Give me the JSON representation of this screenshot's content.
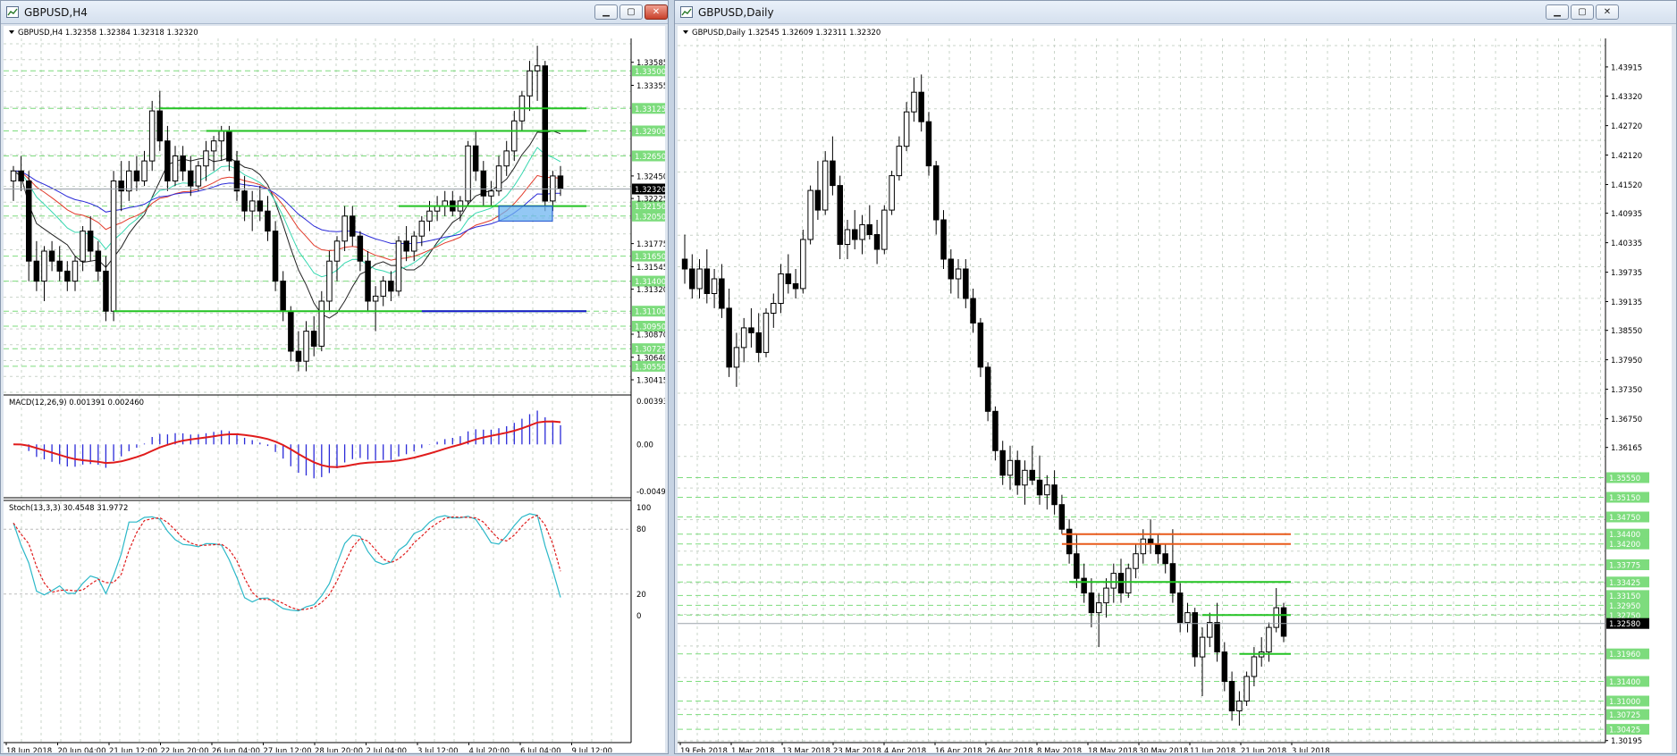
{
  "windows": [
    {
      "title": "GBPUSD,H4",
      "header": "GBPUSD,H4  1.32358 1.32384 1.32318 1.32320",
      "price_range": [
        1.3029,
        1.3377
      ],
      "price_ticks": [
        "1.33585",
        "1.33355",
        "1.32450",
        "1.32225",
        "1.31775",
        "1.31545",
        "1.31320",
        "1.30870",
        "1.30640",
        "1.30415"
      ],
      "current_price": "1.32320",
      "levels": [
        {
          "label": "1.33500",
          "price": 1.335
        },
        {
          "label": "1.33125",
          "price": 1.33125
        },
        {
          "label": "1.32900",
          "price": 1.329
        },
        {
          "label": "1.32650",
          "price": 1.3265
        },
        {
          "label": "1.32150",
          "price": 1.3215
        },
        {
          "label": "1.32050",
          "price": 1.3205
        },
        {
          "label": "1.31650",
          "price": 1.3165
        },
        {
          "label": "1.31400",
          "price": 1.314
        },
        {
          "label": "1.31100",
          "price": 1.311
        },
        {
          "label": "1.30950",
          "price": 1.3095
        },
        {
          "label": "1.30725",
          "price": 1.30725
        },
        {
          "label": "1.30550",
          "price": 1.3055
        }
      ],
      "date_labels": [
        "18 Jun 2018",
        "20 Jun 04:00",
        "21 Jun 12:00",
        "22 Jun 20:00",
        "26 Jun 04:00",
        "27 Jun 12:00",
        "28 Jun 20:00",
        "2 Jul 04:00",
        "3 Jul 12:00",
        "4 Jul 20:00",
        "6 Jul 04:00",
        "9 Jul 12:00"
      ],
      "macd": {
        "header": "MACD(12,26,9) 0.001391 0.002460",
        "ticks": [
          "0.003935",
          "0.00",
          "-0.00494"
        ]
      },
      "stoch": {
        "header": "Stoch(13,3,3) 30.4548 31.9772",
        "ticks": [
          "100",
          "80",
          "20",
          "0"
        ]
      }
    },
    {
      "title": "GBPUSD,Daily",
      "header": "GBPUSD,Daily  1.32545 1.32609 1.32311 1.32320",
      "price_range": [
        1.3019,
        1.4435
      ],
      "price_ticks": [
        "1.43915",
        "1.43320",
        "1.42720",
        "1.42120",
        "1.41520",
        "1.40935",
        "1.40335",
        "1.39735",
        "1.39135",
        "1.38550",
        "1.37950",
        "1.37350",
        "1.36750",
        "1.36165",
        "1.30195"
      ],
      "current_price": "1.32580",
      "levels": [
        {
          "label": "1.35550",
          "price": 1.3555
        },
        {
          "label": "1.35150",
          "price": 1.3515
        },
        {
          "label": "1.34750",
          "price": 1.3475
        },
        {
          "label": "1.34400",
          "price": 1.344
        },
        {
          "label": "1.34200",
          "price": 1.342
        },
        {
          "label": "1.33775",
          "price": 1.33775
        },
        {
          "label": "1.33425",
          "price": 1.33425
        },
        {
          "label": "1.33150",
          "price": 1.3315
        },
        {
          "label": "1.32950",
          "price": 1.3295
        },
        {
          "label": "1.32750",
          "price": 1.3275
        },
        {
          "label": "1.31960",
          "price": 1.3196
        },
        {
          "label": "1.31400",
          "price": 1.314
        },
        {
          "label": "1.31000",
          "price": 1.31
        },
        {
          "label": "1.30725",
          "price": 1.30725
        },
        {
          "label": "1.30425",
          "price": 1.30425
        }
      ],
      "date_labels": [
        "19 Feb 2018",
        "1 Mar 2018",
        "13 Mar 2018",
        "23 Mar 2018",
        "4 Apr 2018",
        "16 Apr 2018",
        "26 Apr 2018",
        "8 May 2018",
        "18 May 2018",
        "30 May 2018",
        "11 Jun 2018",
        "21 Jun 2018",
        "3 Jul 2018"
      ]
    }
  ],
  "chart_data": [
    {
      "type": "candlestick",
      "title": "GBPUSD,H4",
      "ohlc_header": [
        1.32358,
        1.32384,
        1.32318,
        1.3232
      ],
      "ylim": [
        1.3029,
        1.3377
      ],
      "candles": [
        [
          1.324,
          1.3255,
          1.322,
          1.325
        ],
        [
          1.325,
          1.3265,
          1.323,
          1.324
        ],
        [
          1.324,
          1.325,
          1.314,
          1.316
        ],
        [
          1.316,
          1.318,
          1.313,
          1.314
        ],
        [
          1.314,
          1.3175,
          1.312,
          1.317
        ],
        [
          1.317,
          1.318,
          1.315,
          1.316
        ],
        [
          1.316,
          1.3175,
          1.314,
          1.315
        ],
        [
          1.315,
          1.316,
          1.313,
          1.314
        ],
        [
          1.314,
          1.3165,
          1.313,
          1.316
        ],
        [
          1.316,
          1.3195,
          1.315,
          1.319
        ],
        [
          1.319,
          1.3205,
          1.316,
          1.317
        ],
        [
          1.317,
          1.318,
          1.314,
          1.315
        ],
        [
          1.315,
          1.3165,
          1.31,
          1.311
        ],
        [
          1.311,
          1.325,
          1.31,
          1.324
        ],
        [
          1.324,
          1.326,
          1.321,
          1.323
        ],
        [
          1.323,
          1.326,
          1.322,
          1.325
        ],
        [
          1.325,
          1.3265,
          1.323,
          1.324
        ],
        [
          1.324,
          1.327,
          1.3235,
          1.326
        ],
        [
          1.326,
          1.332,
          1.325,
          1.331
        ],
        [
          1.331,
          1.333,
          1.327,
          1.328
        ],
        [
          1.328,
          1.3295,
          1.323,
          1.324
        ],
        [
          1.324,
          1.3275,
          1.3235,
          1.3265
        ],
        [
          1.3265,
          1.3275,
          1.324,
          1.325
        ],
        [
          1.325,
          1.3265,
          1.3225,
          1.3235
        ],
        [
          1.3235,
          1.326,
          1.323,
          1.3255
        ],
        [
          1.3255,
          1.328,
          1.324,
          1.327
        ],
        [
          1.327,
          1.3285,
          1.325,
          1.328
        ],
        [
          1.328,
          1.3295,
          1.326,
          1.329
        ],
        [
          1.329,
          1.3295,
          1.325,
          1.326
        ],
        [
          1.326,
          1.327,
          1.322,
          1.323
        ],
        [
          1.323,
          1.3245,
          1.32,
          1.321
        ],
        [
          1.321,
          1.323,
          1.319,
          1.322
        ],
        [
          1.322,
          1.3235,
          1.32,
          1.321
        ],
        [
          1.321,
          1.3225,
          1.318,
          1.319
        ],
        [
          1.319,
          1.32,
          1.313,
          1.314
        ],
        [
          1.314,
          1.315,
          1.31,
          1.311
        ],
        [
          1.311,
          1.3115,
          1.306,
          1.307
        ],
        [
          1.307,
          1.309,
          1.305,
          1.306
        ],
        [
          1.306,
          1.31,
          1.305,
          1.309
        ],
        [
          1.309,
          1.3105,
          1.3065,
          1.3075
        ],
        [
          1.3075,
          1.313,
          1.307,
          1.312
        ],
        [
          1.312,
          1.317,
          1.311,
          1.316
        ],
        [
          1.316,
          1.3185,
          1.314,
          1.318
        ],
        [
          1.318,
          1.3215,
          1.317,
          1.3205
        ],
        [
          1.3205,
          1.3215,
          1.3175,
          1.3185
        ],
        [
          1.3185,
          1.319,
          1.315,
          1.316
        ],
        [
          1.316,
          1.317,
          1.311,
          1.312
        ],
        [
          1.312,
          1.3135,
          1.309,
          1.3125
        ],
        [
          1.3125,
          1.3145,
          1.3115,
          1.314
        ],
        [
          1.314,
          1.315,
          1.312,
          1.313
        ],
        [
          1.313,
          1.3185,
          1.3125,
          1.318
        ],
        [
          1.318,
          1.3195,
          1.316,
          1.317
        ],
        [
          1.317,
          1.319,
          1.316,
          1.3185
        ],
        [
          1.3185,
          1.3205,
          1.3175,
          1.32
        ],
        [
          1.32,
          1.322,
          1.319,
          1.321
        ],
        [
          1.321,
          1.3225,
          1.32,
          1.3215
        ],
        [
          1.3215,
          1.323,
          1.3205,
          1.322
        ],
        [
          1.322,
          1.323,
          1.3205,
          1.321
        ],
        [
          1.321,
          1.3225,
          1.32,
          1.322
        ],
        [
          1.322,
          1.328,
          1.3215,
          1.3275
        ],
        [
          1.3275,
          1.329,
          1.324,
          1.325
        ],
        [
          1.325,
          1.326,
          1.3215,
          1.3225
        ],
        [
          1.3225,
          1.324,
          1.3215,
          1.323
        ],
        [
          1.323,
          1.3265,
          1.3225,
          1.3255
        ],
        [
          1.3255,
          1.328,
          1.3245,
          1.327
        ],
        [
          1.327,
          1.331,
          1.326,
          1.33
        ],
        [
          1.33,
          1.333,
          1.329,
          1.3325
        ],
        [
          1.3325,
          1.336,
          1.331,
          1.335
        ],
        [
          1.335,
          1.3375,
          1.332,
          1.3355
        ],
        [
          1.3355,
          1.336,
          1.321,
          1.322
        ],
        [
          1.322,
          1.325,
          1.321,
          1.3245
        ],
        [
          1.3245,
          1.3255,
          1.3225,
          1.3232
        ]
      ],
      "indicators": {
        "macd": {
          "params": "12,26,9",
          "values": [
            0.001391,
            0.00246
          ]
        },
        "stochastic": {
          "params": "13,3,3",
          "values": [
            30.4548,
            31.9772
          ]
        }
      }
    },
    {
      "type": "candlestick",
      "title": "GBPUSD,Daily",
      "ohlc_header": [
        1.32545,
        1.32609,
        1.32311,
        1.3232
      ],
      "ylim": [
        1.3019,
        1.4435
      ],
      "candles": [
        [
          1.4,
          1.405,
          1.395,
          1.398
        ],
        [
          1.398,
          1.401,
          1.392,
          1.394
        ],
        [
          1.394,
          1.4,
          1.392,
          1.398
        ],
        [
          1.398,
          1.402,
          1.391,
          1.393
        ],
        [
          1.393,
          1.398,
          1.39,
          1.396
        ],
        [
          1.396,
          1.399,
          1.388,
          1.39
        ],
        [
          1.39,
          1.394,
          1.376,
          1.378
        ],
        [
          1.378,
          1.385,
          1.374,
          1.382
        ],
        [
          1.382,
          1.388,
          1.379,
          1.386
        ],
        [
          1.386,
          1.39,
          1.382,
          1.385
        ],
        [
          1.385,
          1.389,
          1.379,
          1.381
        ],
        [
          1.381,
          1.39,
          1.38,
          1.389
        ],
        [
          1.389,
          1.393,
          1.386,
          1.391
        ],
        [
          1.391,
          1.399,
          1.389,
          1.397
        ],
        [
          1.397,
          1.401,
          1.393,
          1.395
        ],
        [
          1.395,
          1.398,
          1.392,
          1.394
        ],
        [
          1.394,
          1.406,
          1.393,
          1.404
        ],
        [
          1.404,
          1.415,
          1.403,
          1.414
        ],
        [
          1.414,
          1.42,
          1.408,
          1.41
        ],
        [
          1.41,
          1.422,
          1.409,
          1.42
        ],
        [
          1.42,
          1.425,
          1.413,
          1.415
        ],
        [
          1.415,
          1.417,
          1.4,
          1.403
        ],
        [
          1.403,
          1.408,
          1.4,
          1.406
        ],
        [
          1.406,
          1.41,
          1.402,
          1.404
        ],
        [
          1.404,
          1.409,
          1.401,
          1.407
        ],
        [
          1.407,
          1.411,
          1.404,
          1.405
        ],
        [
          1.405,
          1.408,
          1.399,
          1.402
        ],
        [
          1.402,
          1.411,
          1.401,
          1.41
        ],
        [
          1.41,
          1.418,
          1.409,
          1.417
        ],
        [
          1.417,
          1.425,
          1.416,
          1.423
        ],
        [
          1.423,
          1.432,
          1.422,
          1.43
        ],
        [
          1.43,
          1.437,
          1.428,
          1.434
        ],
        [
          1.434,
          1.4376,
          1.426,
          1.428
        ],
        [
          1.428,
          1.43,
          1.417,
          1.419
        ],
        [
          1.419,
          1.42,
          1.405,
          1.408
        ],
        [
          1.408,
          1.41,
          1.398,
          1.4
        ],
        [
          1.4,
          1.402,
          1.393,
          1.396
        ],
        [
          1.396,
          1.4,
          1.392,
          1.398
        ],
        [
          1.398,
          1.4,
          1.39,
          1.392
        ],
        [
          1.392,
          1.394,
          1.385,
          1.387
        ],
        [
          1.387,
          1.388,
          1.376,
          1.378
        ],
        [
          1.378,
          1.379,
          1.367,
          1.369
        ],
        [
          1.369,
          1.37,
          1.359,
          1.361
        ],
        [
          1.361,
          1.363,
          1.354,
          1.356
        ],
        [
          1.356,
          1.362,
          1.353,
          1.359
        ],
        [
          1.359,
          1.361,
          1.352,
          1.354
        ],
        [
          1.354,
          1.359,
          1.35,
          1.357
        ],
        [
          1.357,
          1.362,
          1.354,
          1.355
        ],
        [
          1.355,
          1.36,
          1.35,
          1.352
        ],
        [
          1.352,
          1.356,
          1.349,
          1.354
        ],
        [
          1.354,
          1.357,
          1.348,
          1.35
        ],
        [
          1.35,
          1.352,
          1.344,
          1.345
        ],
        [
          1.345,
          1.347,
          1.338,
          1.34
        ],
        [
          1.34,
          1.344,
          1.333,
          1.335
        ],
        [
          1.335,
          1.338,
          1.33,
          1.332
        ],
        [
          1.332,
          1.335,
          1.325,
          1.328
        ],
        [
          1.328,
          1.332,
          1.321,
          1.33
        ],
        [
          1.33,
          1.335,
          1.327,
          1.333
        ],
        [
          1.333,
          1.338,
          1.33,
          1.336
        ],
        [
          1.336,
          1.339,
          1.33,
          1.332
        ],
        [
          1.332,
          1.338,
          1.331,
          1.337
        ],
        [
          1.337,
          1.342,
          1.335,
          1.34
        ],
        [
          1.34,
          1.345,
          1.338,
          1.343
        ],
        [
          1.343,
          1.347,
          1.34,
          1.342
        ],
        [
          1.342,
          1.344,
          1.338,
          1.34
        ],
        [
          1.34,
          1.342,
          1.336,
          1.338
        ],
        [
          1.338,
          1.345,
          1.33,
          1.332
        ],
        [
          1.332,
          1.334,
          1.324,
          1.326
        ],
        [
          1.326,
          1.33,
          1.324,
          1.328
        ],
        [
          1.328,
          1.329,
          1.317,
          1.319
        ],
        [
          1.319,
          1.325,
          1.311,
          1.323
        ],
        [
          1.323,
          1.328,
          1.321,
          1.326
        ],
        [
          1.326,
          1.33,
          1.318,
          1.32
        ],
        [
          1.32,
          1.322,
          1.312,
          1.314
        ],
        [
          1.314,
          1.316,
          1.306,
          1.308
        ],
        [
          1.308,
          1.312,
          1.305,
          1.31
        ],
        [
          1.31,
          1.316,
          1.309,
          1.315
        ],
        [
          1.315,
          1.321,
          1.313,
          1.319
        ],
        [
          1.319,
          1.323,
          1.317,
          1.32
        ],
        [
          1.32,
          1.326,
          1.318,
          1.325
        ],
        [
          1.325,
          1.333,
          1.324,
          1.329
        ],
        [
          1.329,
          1.33,
          1.322,
          1.3232
        ]
      ]
    }
  ]
}
